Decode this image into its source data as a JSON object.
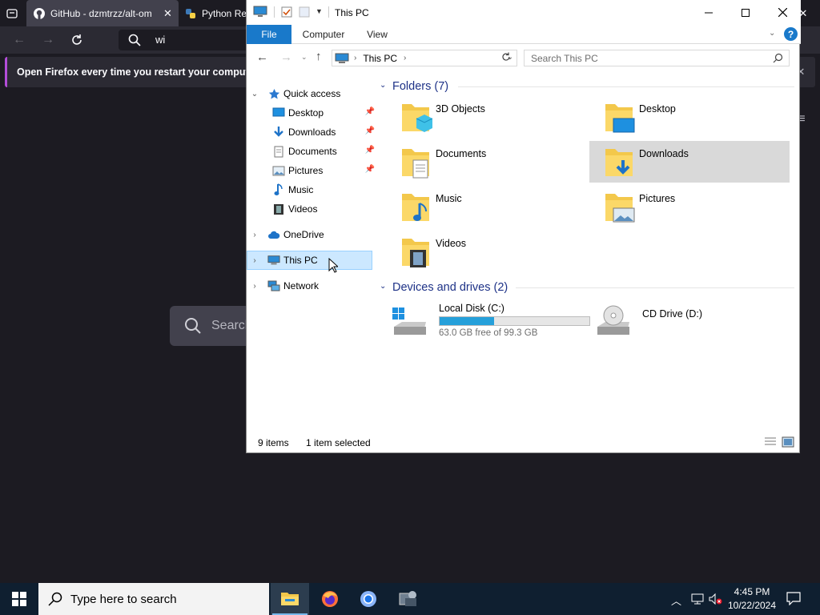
{
  "firefox": {
    "tabs": [
      {
        "label": "GitHub - dzmtrzz/alt-om",
        "icon": "github-icon"
      },
      {
        "label": "Python Re",
        "icon": "python-icon"
      }
    ],
    "url_text": "wi",
    "notification": "Open Firefox every time you restart your computer",
    "page_search_placeholder": "Search"
  },
  "explorer": {
    "title": "This PC",
    "ribbon_tabs": [
      "File",
      "Computer",
      "View"
    ],
    "breadcrumb": "This PC",
    "search_placeholder": "Search This PC",
    "nav": {
      "quick_access": "Quick access",
      "quick_items": [
        "Desktop",
        "Downloads",
        "Documents",
        "Pictures",
        "Music",
        "Videos"
      ],
      "onedrive": "OneDrive",
      "this_pc": "This PC",
      "network": "Network"
    },
    "folders_header": "Folders (7)",
    "folders": [
      {
        "name": "3D Objects",
        "icon": "3d-objects-folder-icon"
      },
      {
        "name": "Desktop",
        "icon": "desktop-folder-icon"
      },
      {
        "name": "Documents",
        "icon": "documents-folder-icon"
      },
      {
        "name": "Downloads",
        "icon": "downloads-folder-icon",
        "selected": true
      },
      {
        "name": "Music",
        "icon": "music-folder-icon"
      },
      {
        "name": "Pictures",
        "icon": "pictures-folder-icon"
      },
      {
        "name": "Videos",
        "icon": "videos-folder-icon"
      }
    ],
    "drives_header": "Devices and drives (2)",
    "drives": [
      {
        "name": "Local Disk (C:)",
        "free_text": "63.0 GB free of 99.3 GB",
        "used_fraction": 0.366
      },
      {
        "name": "CD Drive (D:)"
      }
    ],
    "status": {
      "items": "9 items",
      "selected": "1 item selected"
    }
  },
  "taskbar": {
    "search_placeholder": "Type here to search",
    "time": "4:45 PM",
    "date": "10/22/2024"
  },
  "colors": {
    "accent": "#1979ca",
    "selection": "#cce8ff",
    "drive_bar": "#26a0da"
  }
}
